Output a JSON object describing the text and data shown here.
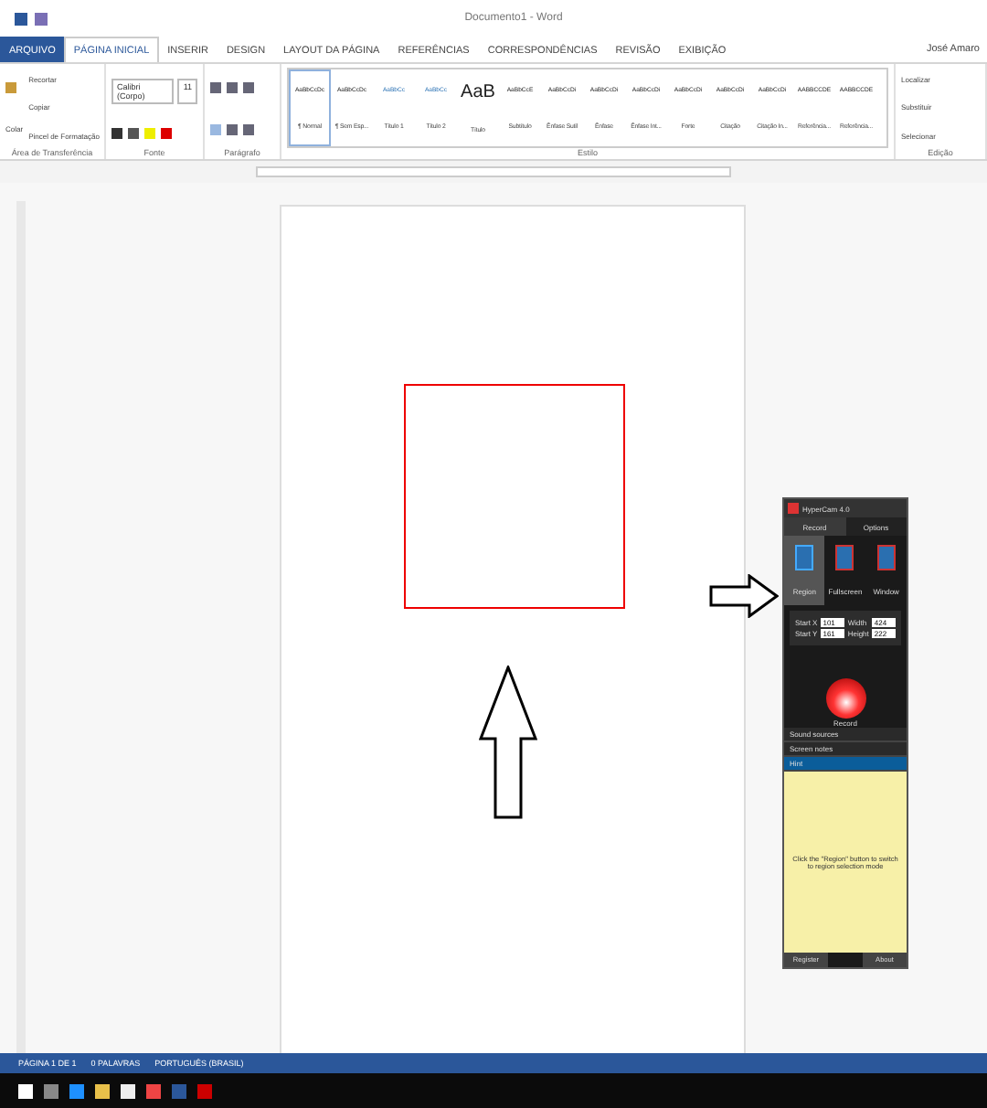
{
  "window": {
    "title": "Documento1 - Word",
    "user": "José Amaro"
  },
  "tabs": [
    {
      "label": "ARQUIVO",
      "kind": "file",
      "selected": false
    },
    {
      "label": "PÁGINA INICIAL",
      "kind": "tab",
      "selected": true
    },
    {
      "label": "INSERIR",
      "kind": "tab",
      "selected": false
    },
    {
      "label": "DESIGN",
      "kind": "tab",
      "selected": false
    },
    {
      "label": "LAYOUT DA PÁGINA",
      "kind": "tab",
      "selected": false
    },
    {
      "label": "REFERÊNCIAS",
      "kind": "tab",
      "selected": false
    },
    {
      "label": "CORRESPONDÊNCIAS",
      "kind": "tab",
      "selected": false
    },
    {
      "label": "REVISÃO",
      "kind": "tab",
      "selected": false
    },
    {
      "label": "EXIBIÇÃO",
      "kind": "tab",
      "selected": false
    }
  ],
  "clipboard": {
    "paste": "Colar",
    "items": [
      "Recortar",
      "Copiar",
      "Pincel de Formatação"
    ],
    "label": "Área de Transferência"
  },
  "font": {
    "name": "Calibri (Corpo)",
    "size": "11",
    "label": "Fonte"
  },
  "paragraph": {
    "label": "Parágrafo"
  },
  "styles": {
    "label": "Estilo",
    "items": [
      {
        "preview": "AaBbCcDc",
        "name": "¶ Normal",
        "selected": true
      },
      {
        "preview": "AaBbCcDc",
        "name": "¶ Sem Esp...",
        "selected": false
      },
      {
        "preview": "AaBbCc",
        "name": "Título 1",
        "selected": false
      },
      {
        "preview": "AaBbCc",
        "name": "Título 2",
        "selected": false
      },
      {
        "preview": "AaB",
        "name": "Título",
        "selected": false
      },
      {
        "preview": "AaBbCcE",
        "name": "Subtítulo",
        "selected": false
      },
      {
        "preview": "AaBbCcDi",
        "name": "Ênfase Sutil",
        "selected": false
      },
      {
        "preview": "AaBbCcDi",
        "name": "Ênfase",
        "selected": false
      },
      {
        "preview": "AaBbCcDi",
        "name": "Ênfase Int...",
        "selected": false
      },
      {
        "preview": "AaBbCcDi",
        "name": "Forte",
        "selected": false
      },
      {
        "preview": "AaBbCcDi",
        "name": "Citação",
        "selected": false
      },
      {
        "preview": "AaBbCcDi",
        "name": "Citação In...",
        "selected": false
      },
      {
        "preview": "AABBCCDE",
        "name": "Referência...",
        "selected": false
      },
      {
        "preview": "AABBCCDE",
        "name": "Referência...",
        "selected": false
      }
    ]
  },
  "editing": {
    "label": "Edição",
    "items": [
      "Localizar",
      "Substituir",
      "Selecionar"
    ]
  },
  "recorder": {
    "title": "HyperCam 4.0",
    "tabs": [
      {
        "label": "Record",
        "selected": true
      },
      {
        "label": "Options",
        "selected": false
      }
    ],
    "modes": [
      {
        "label": "Region",
        "selected": true
      },
      {
        "label": "Fullscreen",
        "selected": false
      },
      {
        "label": "Window",
        "selected": false
      }
    ],
    "fields": [
      {
        "label": "Start X",
        "value": "101"
      },
      {
        "label": "Width",
        "value": "424"
      },
      {
        "label": "Start Y",
        "value": "161"
      },
      {
        "label": "Height",
        "value": "222"
      }
    ],
    "record": "Record",
    "sections": [
      {
        "label": "Sound sources",
        "expanded": false
      },
      {
        "label": "Screen notes",
        "expanded": false
      },
      {
        "label": "Hint",
        "expanded": true
      }
    ],
    "hint": "Click the \"Region\" button to switch to region selection mode",
    "buttons": [
      "Register",
      "About"
    ]
  },
  "status_bar": {
    "items": [
      "PÁGINA 1 DE 1",
      "0 PALAVRAS",
      "PORTUGUÊS (BRASIL)"
    ]
  }
}
